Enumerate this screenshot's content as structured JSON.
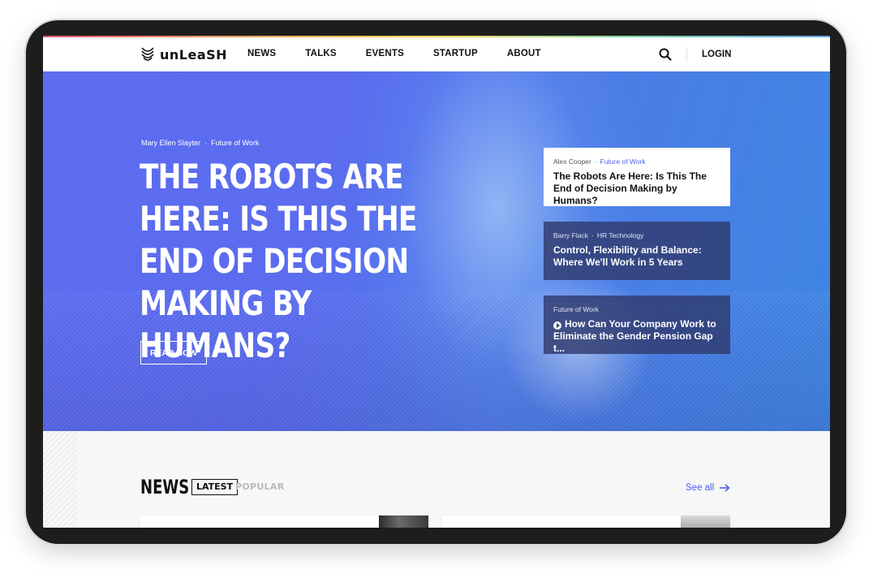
{
  "nav": {
    "logo_text": "unLeaSH",
    "items": [
      "NEWS",
      "TALKS",
      "EVENTS",
      "STARTUP",
      "ABOUT"
    ],
    "login": "LOGIN",
    "search_icon": "search-icon"
  },
  "hero": {
    "author": "Mary Ellen Slayter",
    "separator": "·",
    "category": "Future of Work",
    "headline": "THE ROBOTS ARE HERE: IS THIS THE END OF DECISION MAKING BY HUMANS?",
    "cta": "READ NOW"
  },
  "cards": [
    {
      "author": "Alex Cooper",
      "category": "Future of Work",
      "title": "The Robots Are Here: Is This The End of Decision Making by Humans?"
    },
    {
      "author": "Barry Flack",
      "category": "HR Technology",
      "title": "Control, Flexibility and Balance: Where We'll Work in 5 Years"
    },
    {
      "category": "Future of Work",
      "title": "How Can Your Company Work to Eliminate the Gender Pension Gap t..."
    }
  ],
  "news": {
    "title": "NEWS",
    "tab_latest": "LATEST",
    "tab_popular": "POPULAR",
    "see_all": "See all"
  },
  "colors": {
    "accent": "#4a5ff0",
    "hero_blue": "#5b6cef"
  }
}
